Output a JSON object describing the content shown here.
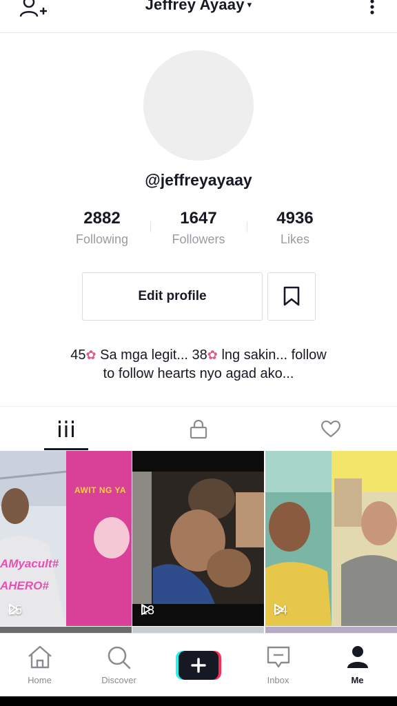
{
  "header": {
    "title": "Jeffrey Ayaay",
    "caret": "▾"
  },
  "profile": {
    "username": "@jeffreyayaay",
    "stats": [
      {
        "value": "2882",
        "label": "Following"
      },
      {
        "value": "1647",
        "label": "Followers"
      },
      {
        "value": "4936",
        "label": "Likes"
      }
    ],
    "edit_label": "Edit profile",
    "bio": {
      "part1": "45",
      "part2": " Sa mga legit...  38",
      "part3": " lng sakin... follow",
      "line2": "to follow hearts nyo agad ako..."
    }
  },
  "videos": [
    {
      "views": "25",
      "overlay_top": "AWIT NG YA",
      "overlay_mid": "AMyacult#",
      "overlay_low": "AHERO#"
    },
    {
      "views": "13"
    },
    {
      "views": "34"
    }
  ],
  "nav": {
    "items": [
      {
        "label": "Home"
      },
      {
        "label": "Discover"
      },
      {
        "label": "Inbox"
      },
      {
        "label": "Me"
      }
    ]
  },
  "colors": {
    "accent_cyan": "#25f4ee",
    "accent_red": "#fe2c55",
    "text": "#161823",
    "muted": "#9a9ba0"
  }
}
